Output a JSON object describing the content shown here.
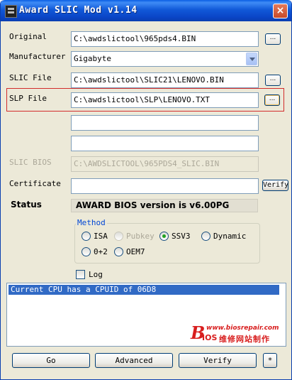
{
  "window": {
    "title": "Award SLIC Mod v1.14",
    "close_glyph": "×"
  },
  "fields": {
    "original": {
      "label": "Original",
      "value": "C:\\awdslictool\\965pds4.BIN",
      "browse": "..."
    },
    "manufacturer": {
      "label": "Manufacturer",
      "value": "Gigabyte"
    },
    "slic_file": {
      "label": "SLIC File",
      "value": "C:\\awdslictool\\SLIC21\\LENOVO.BIN",
      "browse": "..."
    },
    "slp_file": {
      "label": "SLP File",
      "value": "C:\\awdslictool\\SLP\\LENOVO.TXT",
      "browse": "..."
    },
    "extra1": {
      "value": ""
    },
    "extra2": {
      "value": ""
    },
    "slic_bios": {
      "label": "SLIC BIOS",
      "value": "C:\\AWDSLICTOOL\\965PDS4_SLIC.BIN"
    },
    "certificate": {
      "label": "Certificate",
      "value": "",
      "verify": "Verify"
    }
  },
  "status": {
    "label": "Status",
    "value": "AWARD BIOS version is v6.00PG"
  },
  "method": {
    "legend": "Method",
    "options": [
      {
        "label": "ISA",
        "selected": false,
        "enabled": true
      },
      {
        "label": "Pubkey",
        "selected": false,
        "enabled": false
      },
      {
        "label": "SSV3",
        "selected": true,
        "enabled": true
      },
      {
        "label": "Dynamic",
        "selected": false,
        "enabled": true
      },
      {
        "label": "0+2",
        "selected": false,
        "enabled": true
      },
      {
        "label": "OEM7",
        "selected": false,
        "enabled": true
      }
    ]
  },
  "log": {
    "label": "Log",
    "checked": false,
    "lines": [
      "Current CPU has a CPUID of 06D8"
    ]
  },
  "brand": {
    "initial": "B",
    "url": "www.biosrepair.com",
    "suffix": "IOS",
    "chinese": "维修网站制作"
  },
  "buttons": {
    "go": "Go",
    "advanced": "Advanced",
    "verify": "Verify",
    "small": "*"
  },
  "colors": {
    "title_bar": "#0a45c7",
    "highlight_border": "#d22c2c",
    "selection": "#316ac5",
    "brand": "#d81e1e"
  }
}
